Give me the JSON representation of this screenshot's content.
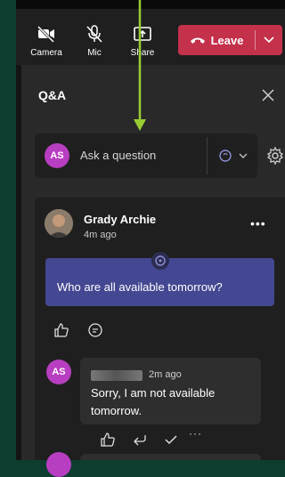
{
  "toolbar": {
    "camera_label": "Camera",
    "mic_label": "Mic",
    "share_label": "Share",
    "leave_label": "Leave",
    "leave_color": "#c4314b"
  },
  "panel": {
    "title": "Q&A",
    "close_icon": "close-icon"
  },
  "ask": {
    "avatar_initials": "AS",
    "placeholder": "Ask a question",
    "type_icon": "question-type-icon",
    "settings_icon": "gear-icon"
  },
  "question": {
    "author": "Grady Archie",
    "time": "4m ago",
    "text": "Who are all available tomorrow?",
    "bubble_color": "#444791",
    "actions": [
      "like-icon",
      "reply-icon"
    ]
  },
  "reply": {
    "avatar_initials": "AS",
    "time": "2m ago",
    "text": "Sorry, I am not available tomorrow.",
    "actions": [
      "like-icon",
      "reply-arrow-icon",
      "checkmark-icon",
      "more-icon"
    ]
  },
  "colors": {
    "accent_avatar": "#b83ec1",
    "annotation_arrow": "#9acd32"
  }
}
